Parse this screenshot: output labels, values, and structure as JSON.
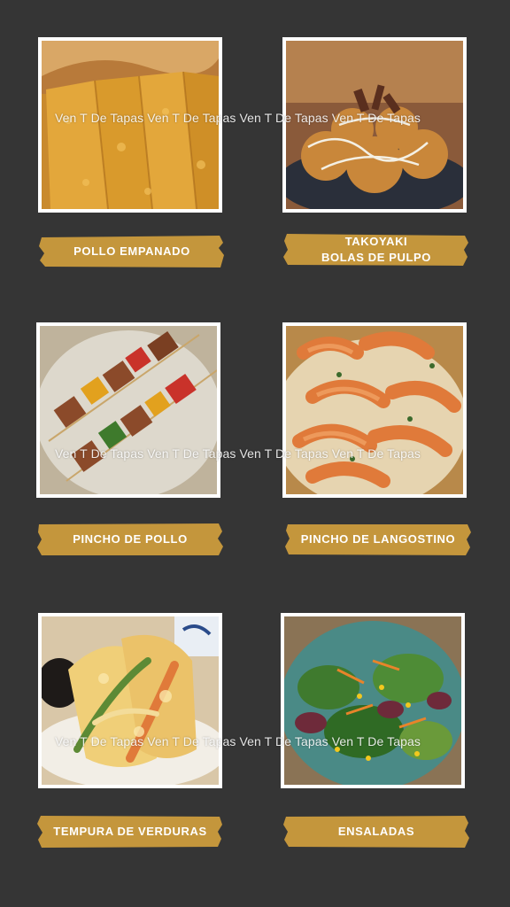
{
  "watermark_text": "Ven T De Tapas  Ven T De Tapas  Ven T De Tapas  Ven T De Tapas",
  "items": [
    {
      "label": "POLLO EMPANADO",
      "image": "fried-chicken-cutlet"
    },
    {
      "label": "TAKOYAKI\nBOLAS  DE PULPO",
      "image": "takoyaki"
    },
    {
      "label": "PINCHO DE POLLO",
      "image": "chicken-skewers"
    },
    {
      "label": "PINCHO DE LANGOSTINO",
      "image": "grilled-prawns"
    },
    {
      "label": "TEMPURA DE VERDURAS",
      "image": "vegetable-tempura"
    },
    {
      "label": "ENSALADAS",
      "image": "mixed-salad"
    }
  ],
  "colors": {
    "background": "#353535",
    "label_bg": "#c4963c",
    "frame": "#ffffff"
  }
}
